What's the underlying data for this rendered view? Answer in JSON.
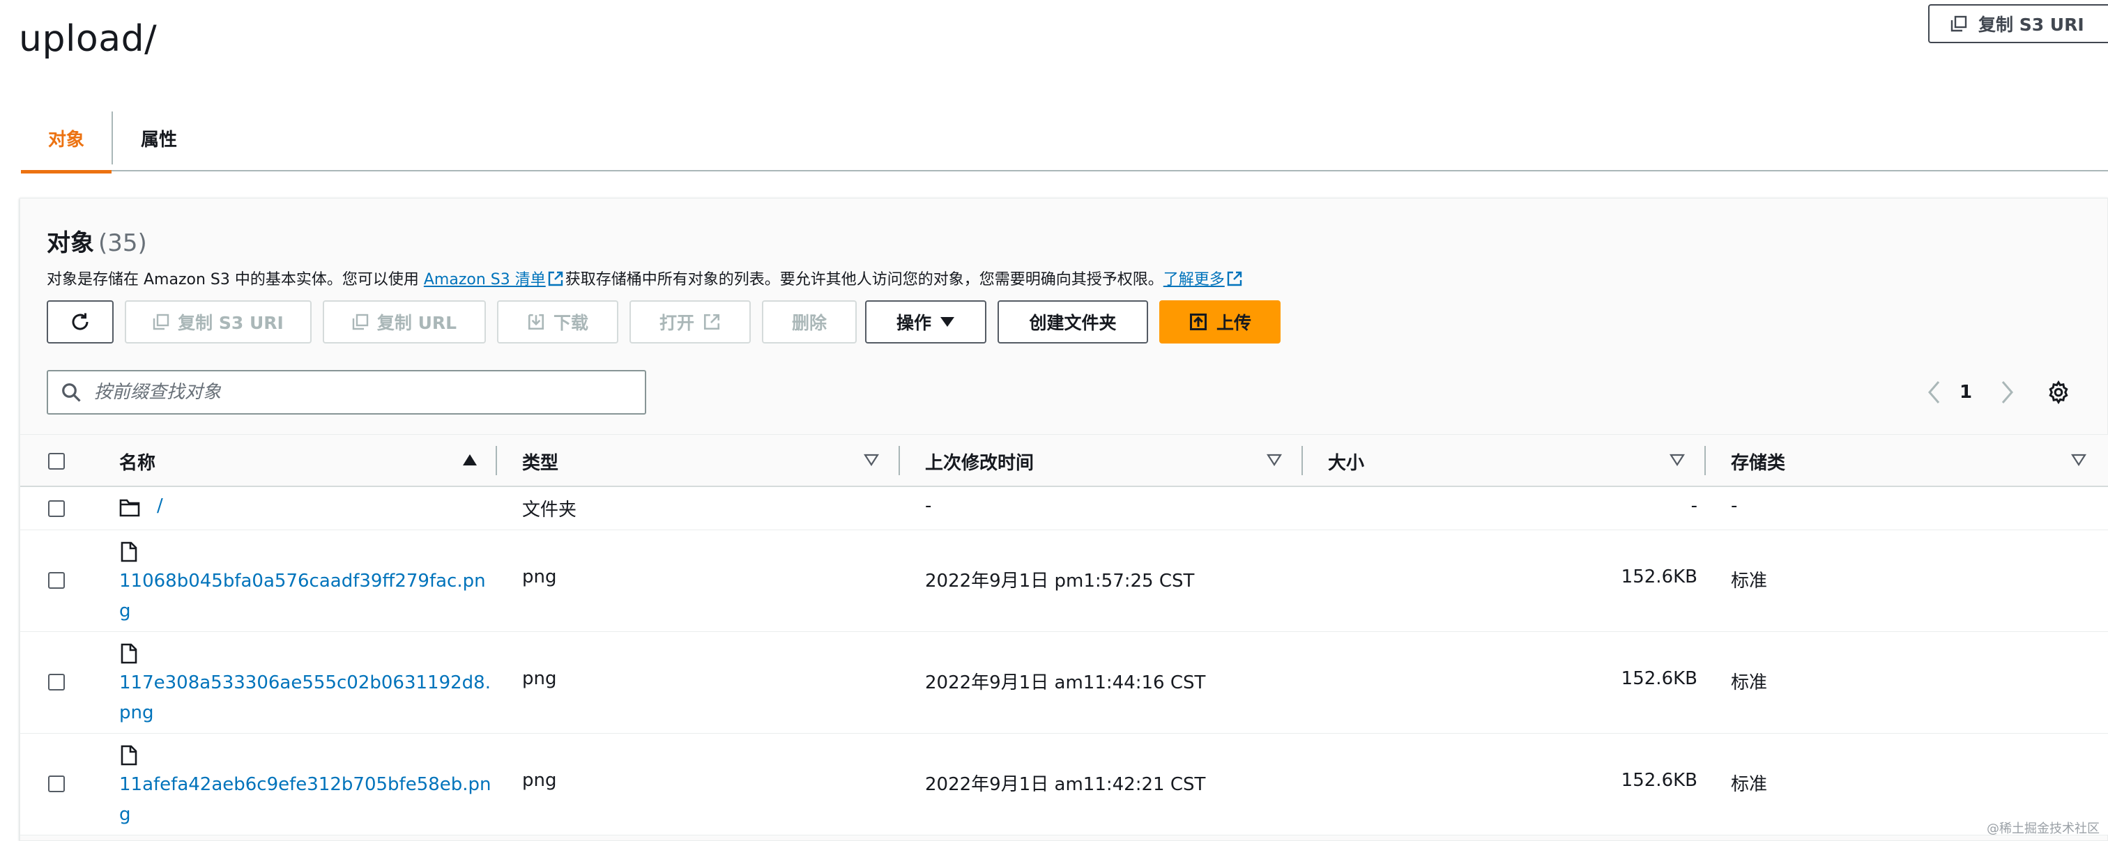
{
  "header": {
    "title": "upload/",
    "copy_s3_uri": "复制 S3 URI"
  },
  "tabs": [
    {
      "label": "对象",
      "active": true
    },
    {
      "label": "属性",
      "active": false
    }
  ],
  "objects": {
    "title": "对象",
    "count": "(35)",
    "desc_prefix": "对象是存储在 Amazon S3 中的基本实体。您可以使用 ",
    "desc_link1": "Amazon S3 清单",
    "desc_middle": "获取存储桶中所有对象的列表。要允许其他人访问您的对象，您需要明确向其授予权限。",
    "desc_link2": "了解更多"
  },
  "toolbar": {
    "copy_s3_uri": "复制 S3 URI",
    "copy_url": "复制 URL",
    "download": "下载",
    "open": "打开",
    "delete": "删除",
    "actions": "操作",
    "create_folder": "创建文件夹",
    "upload": "上传"
  },
  "search": {
    "placeholder": "按前缀查找对象"
  },
  "pagination": {
    "current_page": "1"
  },
  "table": {
    "columns": [
      "名称",
      "类型",
      "上次修改时间",
      "大小",
      "存储类"
    ],
    "folder_row": {
      "name": "/",
      "type": "文件夹",
      "modified": "-",
      "size": "-",
      "storage": "-"
    },
    "rows": [
      {
        "name": "11068b045bfa0a576caadf39ff279fac.png",
        "type": "png",
        "modified": "2022年9月1日 pm1:57:25 CST",
        "size": "152.6KB",
        "storage": "标准"
      },
      {
        "name": "117e308a533306ae555c02b0631192d8.png",
        "type": "png",
        "modified": "2022年9月1日 am11:44:16 CST",
        "size": "152.6KB",
        "storage": "标准"
      },
      {
        "name": "11afefa42aeb6c9efe312b705bfe58eb.png",
        "type": "png",
        "modified": "2022年9月1日 am11:42:21 CST",
        "size": "152.6KB",
        "storage": "标准"
      }
    ]
  },
  "watermark": "@稀土掘金技术社区"
}
